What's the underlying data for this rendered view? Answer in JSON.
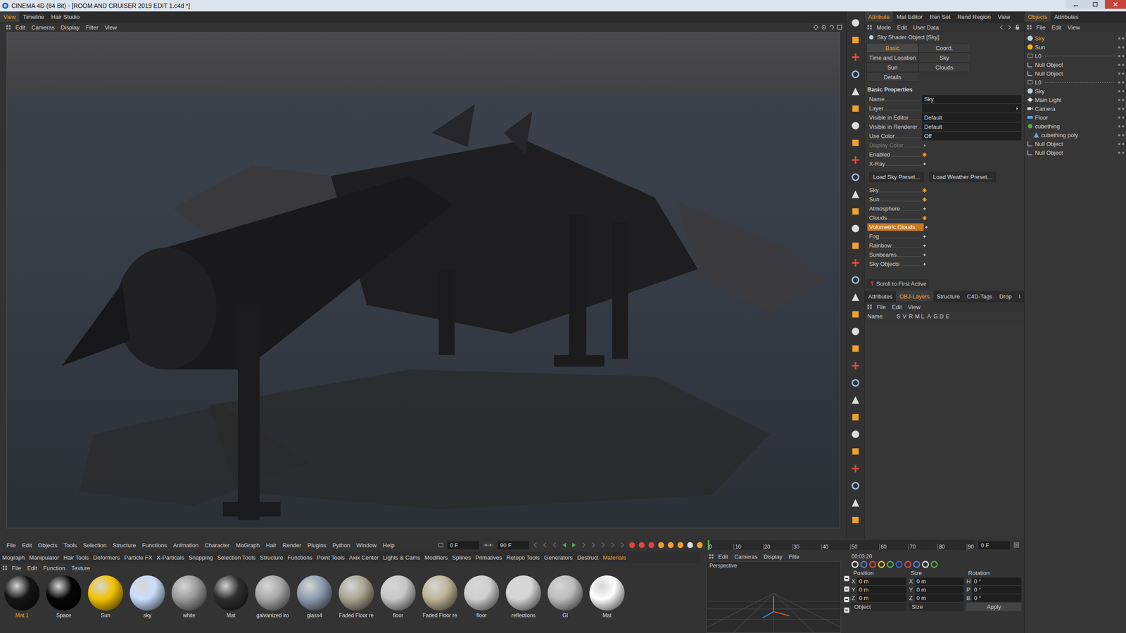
{
  "window": {
    "title": "CINEMA 4D (64 Bit) - [ROOM AND CRUISER 2019 EDIT 1.c4d *]"
  },
  "layout_tabs": [
    {
      "label": "View",
      "selected": true
    },
    {
      "label": "Timeline",
      "selected": false
    },
    {
      "label": "Hair Studio",
      "selected": false
    }
  ],
  "viewport_menu": [
    "Edit",
    "Cameras",
    "Display",
    "Filter",
    "View"
  ],
  "attributes": {
    "tabs": [
      {
        "label": "Attribute",
        "selected": true
      },
      {
        "label": "Mat Editor",
        "selected": false
      },
      {
        "label": "Ren Set",
        "selected": false
      },
      {
        "label": "Rend Region",
        "selected": false
      },
      {
        "label": "View",
        "selected": false
      }
    ],
    "menu": [
      "Mode",
      "Edit",
      "User Data"
    ],
    "object_title": "Sky Shader Object [Sky]",
    "page_tabs": [
      {
        "label": "Basic",
        "selected": true
      },
      {
        "label": "Coord.",
        "selected": false
      },
      {
        "label": "Time and Location",
        "selected": false
      },
      {
        "label": "Sky",
        "selected": false
      },
      {
        "label": "Sun",
        "selected": false
      },
      {
        "label": "Clouds",
        "selected": false
      },
      {
        "label": "Details",
        "selected": false
      }
    ],
    "section": "Basic Properties",
    "fields": [
      {
        "label": "Name",
        "kind": "text",
        "value": "Sky",
        "disabled": false
      },
      {
        "label": "Layer",
        "kind": "dropdown",
        "disabled": false
      },
      {
        "label": "Visible in Editor",
        "kind": "text",
        "value": "Default",
        "disabled": false
      },
      {
        "label": "Visible in Renderer",
        "kind": "text",
        "value": "Default",
        "disabled": false
      },
      {
        "label": "Use Color",
        "kind": "text",
        "value": "Off",
        "disabled": false
      },
      {
        "label": "Display Color",
        "kind": "color",
        "disabled": true
      }
    ],
    "flags": [
      {
        "label": "Enabled",
        "checked": true
      },
      {
        "label": "X-Ray",
        "checked": false
      }
    ],
    "presets": [
      "Load Sky Preset...",
      "Load Weather Preset..."
    ],
    "toggles": [
      {
        "label": "Sky",
        "checked": true,
        "highlighted": false
      },
      {
        "label": "Sun",
        "checked": true,
        "highlighted": false
      },
      {
        "label": "Atmosphere",
        "checked": false,
        "highlighted": false
      },
      {
        "label": "Clouds",
        "checked": true,
        "highlighted": false
      },
      {
        "label": "Volumetric Clouds",
        "checked": false,
        "highlighted": true
      },
      {
        "label": "Fog",
        "checked": false,
        "highlighted": false
      },
      {
        "label": "Rainbow",
        "checked": false,
        "highlighted": false
      },
      {
        "label": "Sunbeams",
        "checked": false,
        "highlighted": false
      },
      {
        "label": "Sky Objects",
        "checked": false,
        "highlighted": false
      }
    ],
    "scroll_button": "Scroll to First Active"
  },
  "layers_panel": {
    "tabs": [
      {
        "label": "Attributes",
        "selected": false
      },
      {
        "label": "OBJ-Layers",
        "selected": true
      },
      {
        "label": "Structure",
        "selected": false
      },
      {
        "label": "C4D-Tags",
        "selected": false
      },
      {
        "label": "Drop",
        "selected": false
      },
      {
        "label": "I",
        "selected": false
      }
    ],
    "menu": [
      "File",
      "Edit",
      "View"
    ],
    "name_column": "Name",
    "flags": [
      "S",
      "V",
      "R",
      "M",
      "L",
      "A",
      "G",
      "D",
      "E"
    ]
  },
  "objects": {
    "tabs": [
      {
        "label": "Objects",
        "selected": true
      },
      {
        "label": "Attributes",
        "selected": false
      }
    ],
    "menu": [
      "File",
      "Edit",
      "View"
    ],
    "items": [
      {
        "name": "Sky",
        "kind": "sky",
        "selected": true,
        "child": false
      },
      {
        "name": "Sun",
        "kind": "sun",
        "selected": false,
        "child": false
      },
      {
        "name": "L0",
        "kind": "layer",
        "selected": false,
        "child": false
      },
      {
        "name": "Null Object",
        "kind": "null",
        "selected": false,
        "child": false
      },
      {
        "name": "Null Object",
        "kind": "null",
        "selected": false,
        "child": false
      },
      {
        "name": "L0",
        "kind": "layer",
        "selected": false,
        "child": false
      },
      {
        "name": "Sky",
        "kind": "sky",
        "selected": false,
        "child": false
      },
      {
        "name": "Main Light",
        "kind": "light",
        "selected": false,
        "child": false
      },
      {
        "name": "Camera",
        "kind": "camera",
        "selected": false,
        "child": false
      },
      {
        "name": "Floor",
        "kind": "floor",
        "selected": false,
        "child": false
      },
      {
        "name": "cubething",
        "kind": "group",
        "selected": false,
        "child": false
      },
      {
        "name": "cubething poly",
        "kind": "poly",
        "selected": false,
        "child": true
      },
      {
        "name": "Null Object",
        "kind": "null",
        "selected": false,
        "child": false
      },
      {
        "name": "Null Object",
        "kind": "null",
        "selected": false,
        "child": false
      }
    ]
  },
  "main_menu": [
    "File",
    "Edit",
    "Objects",
    "Tools",
    "Selection",
    "Structure",
    "Functions",
    "Animation",
    "Character",
    "MoGraph",
    "Hair",
    "Render",
    "Plugins",
    "Python",
    "Window",
    "Help"
  ],
  "timeline": {
    "start": "0 F",
    "end": "90 F",
    "current": "0 F",
    "playhead": 0,
    "ticks": [
      "0",
      "10",
      "20",
      "30",
      "40",
      "50",
      "60",
      "70",
      "80",
      "90"
    ]
  },
  "toolbar_tabs": [
    {
      "label": "Mograph",
      "selected": false
    },
    {
      "label": "Manipulator",
      "selected": false
    },
    {
      "label": "Hair Tools",
      "selected": false
    },
    {
      "label": "Deformers",
      "selected": false
    },
    {
      "label": "Particle FX",
      "selected": false
    },
    {
      "label": "X-Particals",
      "selected": false
    },
    {
      "label": "Snapping",
      "selected": false
    },
    {
      "label": "Selection Tools",
      "selected": false
    },
    {
      "label": "Structure",
      "selected": false
    },
    {
      "label": "Functions",
      "selected": false
    },
    {
      "label": "Point Tools",
      "selected": false
    },
    {
      "label": "Axix Center",
      "selected": false
    },
    {
      "label": "Lights & Cams",
      "selected": false
    },
    {
      "label": "Modifiers",
      "selected": false
    },
    {
      "label": "Splines",
      "selected": false
    },
    {
      "label": "Primatives",
      "selected": false
    },
    {
      "label": "Retopo Tools",
      "selected": false
    },
    {
      "label": "Generators",
      "selected": false
    },
    {
      "label": "Destruct",
      "selected": false
    },
    {
      "label": "Materials",
      "selected": true
    }
  ],
  "materials": {
    "menu": [
      "File",
      "Edit",
      "Function",
      "Texture"
    ],
    "items": [
      {
        "name": "Mat.1",
        "selected": true,
        "color": "#151515"
      },
      {
        "name": "Space",
        "selected": false,
        "color": "#050505"
      },
      {
        "name": "Sun",
        "selected": false,
        "color": "#f2c200"
      },
      {
        "name": "sky",
        "selected": false,
        "color": "#c9ddfb"
      },
      {
        "name": "white",
        "selected": false,
        "color": "#9a9a9a"
      },
      {
        "name": "Mat",
        "selected": false,
        "color": "#2e2e2e"
      },
      {
        "name": "galvanized iro",
        "selected": false,
        "color": "#a8a8a8"
      },
      {
        "name": "glass4",
        "selected": false,
        "color": "#8c9cae"
      },
      {
        "name": "Faded Floor re",
        "selected": false,
        "color": "#a9a48f"
      },
      {
        "name": "floor",
        "selected": false,
        "color": "#c7c7c7"
      },
      {
        "name": "Faded Floor re",
        "selected": false,
        "color": "#bdb497"
      },
      {
        "name": "floor",
        "selected": false,
        "color": "#cfcfcf"
      },
      {
        "name": "reflections",
        "selected": false,
        "color": "#d6d6d6"
      },
      {
        "name": "GI",
        "selected": false,
        "color": "#bcbcbc"
      },
      {
        "name": "Mat",
        "selected": false,
        "color": "#ffffff"
      }
    ]
  },
  "mini_view": {
    "menu": [
      "Edit",
      "Cameras",
      "Display",
      "Filte"
    ],
    "label": "Perspective"
  },
  "coordinates": {
    "time": "00:03:20",
    "headers": [
      "Position",
      "Size",
      "Rotation"
    ],
    "rows": [
      {
        "pos_axis": "X",
        "pos": "0 m",
        "size_axis": "X",
        "size": "0 m",
        "rot_axis": "H",
        "rot": "0 °"
      },
      {
        "pos_axis": "Y",
        "pos": "0 m",
        "size_axis": "Y",
        "size": "0 m",
        "rot_axis": "P",
        "rot": "0 °"
      },
      {
        "pos_axis": "Z",
        "pos": "0 m",
        "size_axis": "Z",
        "size": "0 m",
        "rot_axis": "B",
        "rot": "0 °"
      }
    ],
    "modes": [
      "Object",
      "Size"
    ],
    "apply": "Apply"
  }
}
